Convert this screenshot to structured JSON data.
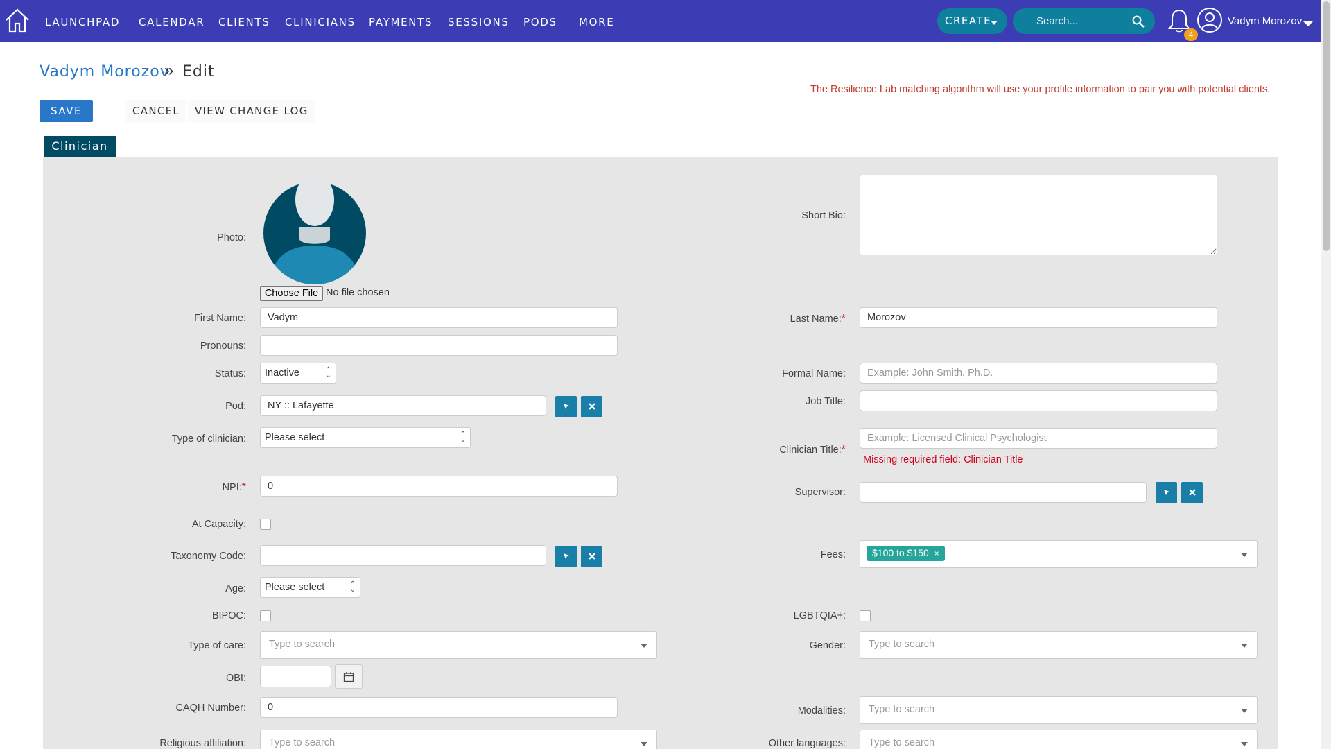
{
  "nav": {
    "items": [
      "LAUNCHPAD",
      "CALENDAR",
      "CLIENTS",
      "CLINICIANS",
      "PAYMENTS",
      "SESSIONS",
      "PODS",
      "MORE"
    ],
    "create_label": "CREATE",
    "search_placeholder": "Search...",
    "notification_count": "4",
    "user_name": "Vadym Morozov"
  },
  "header": {
    "breadcrumb_name": "Vadym Morozov",
    "breadcrumb_sep": "»",
    "breadcrumb_current": "Edit",
    "notice": "The Resilience Lab matching algorithm will use your profile information to pair you with potential clients.",
    "save": "SAVE",
    "cancel": "CANCEL",
    "change_log": "VIEW CHANGE LOG",
    "tab": "Clinician"
  },
  "form": {
    "photo_label": "Photo:",
    "choose_file": "Choose File",
    "no_file": "No file chosen",
    "short_bio_label": "Short Bio:",
    "first_name_label": "First Name:",
    "first_name": "Vadym",
    "last_name_label": "Last Name:",
    "last_name": "Morozov",
    "pronouns_label": "Pronouns:",
    "status_label": "Status:",
    "status": "Inactive",
    "formal_name_label": "Formal Name:",
    "formal_name_placeholder": "Example: John Smith, Ph.D.",
    "pod_label": "Pod:",
    "pod": "NY :: Lafayette",
    "job_title_label": "Job Title:",
    "type_clinician_label": "Type of clinician:",
    "type_clinician": "Please select",
    "clinician_title_label": "Clinician Title:",
    "clinician_title_placeholder": "Example: Licensed Clinical Psychologist",
    "clinician_title_error": "Missing required field: Clinician Title",
    "npi_label": "NPI:",
    "npi": "0",
    "supervisor_label": "Supervisor:",
    "at_capacity_label": "At Capacity:",
    "taxonomy_label": "Taxonomy Code:",
    "fees_label": "Fees:",
    "fees_tag": "$100 to $150",
    "age_label": "Age:",
    "age": "Please select",
    "bipoc_label": "BIPOC:",
    "lgbtqia_label": "LGBTQIA+:",
    "type_of_care_label": "Type of care:",
    "gender_label": "Gender:",
    "type_to_search": "Type to search",
    "obi_label": "OBI:",
    "caqh_label": "CAQH Number:",
    "caqh": "0",
    "modalities_label": "Modalities:",
    "religious_label": "Religious affiliation:",
    "other_languages_label": "Other languages:",
    "required_mark": "*"
  },
  "colors": {
    "nav_bg": "#3c3db5",
    "accent_teal": "#0f7f9e",
    "link_blue": "#2977c9",
    "tab_dark": "#004a63",
    "error_red": "#d0021b",
    "tag_green": "#26a69a"
  }
}
